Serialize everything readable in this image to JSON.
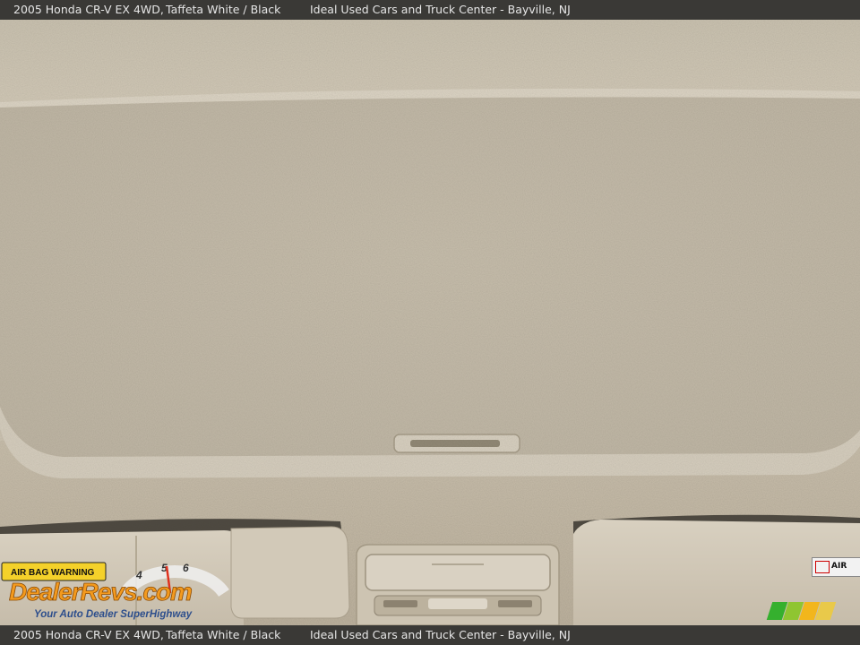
{
  "caption": {
    "model": "2005 Honda CR-V EX 4WD,",
    "color": "Taffeta White / Black",
    "dealer": "Ideal Used Cars and Truck Center - Bayville, NJ"
  },
  "watermark": {
    "airbag_sticker": "AIR BAG WARNING",
    "brand": "DealerRevs.com",
    "tagline": "Your Auto Dealer SuperHighway",
    "gauge_numbers": [
      "4",
      "5",
      "6"
    ]
  },
  "sticker_right": {
    "text": "AIR"
  },
  "colors": {
    "headliner": "#cfc6b4",
    "bar": "#3a3936",
    "brand_blue": "#2d73c8",
    "brand_orange": "#f39a1e"
  }
}
